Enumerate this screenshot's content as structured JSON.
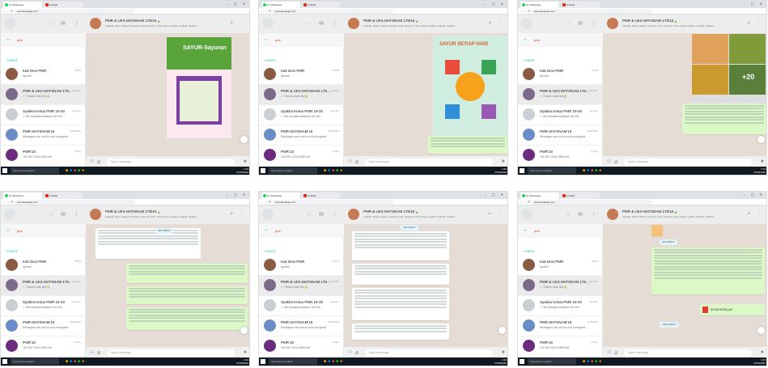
{
  "browser": {
    "tab1": "(1) WhatsApp",
    "tab2": "Untitled",
    "url": "web.whatsapp.com",
    "win_controls": "– ▢ ✕"
  },
  "search": {
    "query": "pmr"
  },
  "chats_label": "CHATS",
  "chats": [
    {
      "name": "Kak Devi PMR",
      "preview": "Apotek",
      "time": "08.52",
      "avatar_color": "#8a5a44"
    },
    {
      "name": "PMR & UKS MATSNAM 178...",
      "preview": "✓ Thank u kak dev🙏",
      "time": "kemarin",
      "avatar_color": "#7b6a88"
    },
    {
      "name": "Syakira Ketua PMR 19-20",
      "preview": "✓ We Assalamualaikum Wr.Wb",
      "time": "kemarin",
      "avatar_color": "#c9cfd2"
    },
    {
      "name": "PMR MATSNAM'19",
      "preview": "Messages are end-to-end encrypted.",
      "time": "3/26/2020",
      "avatar_color": "#6a8cc7"
    },
    {
      "name": "PMR'18",
      "preview": "+62 897-3244-9550 left",
      "time": "Friday",
      "avatar_color": "#6b2b7e"
    }
  ],
  "group": {
    "name": "PMR & UKS MATSNAM 178/16🍃",
    "members": "Claudia, Dhea, Dhea II, Evelina, Fats, Nera Kri, Fitria, Rara, Syarifa, Syahila, Syahira..."
  },
  "composer": {
    "placeholder": "Type a message"
  },
  "taskbar": {
    "search": "Type here to search",
    "time": "1:33",
    "date": "27/05/2020"
  },
  "icons": {
    "status": "status-icon",
    "newchat": "chat-icon",
    "menu": "menu-icon",
    "search": "search-icon",
    "emoji": "emoji-icon",
    "attach": "attach-icon",
    "mic": "mic-icon"
  },
  "banners": {
    "sayur": "SAYUR-Sayuran",
    "sayur_setiap": "SAYUR SETIAP HARI",
    "plus20": "+20",
    "file": "KESEHATAN.pdf",
    "date1": "SATURDAY",
    "date2": "YESTERDAY"
  }
}
